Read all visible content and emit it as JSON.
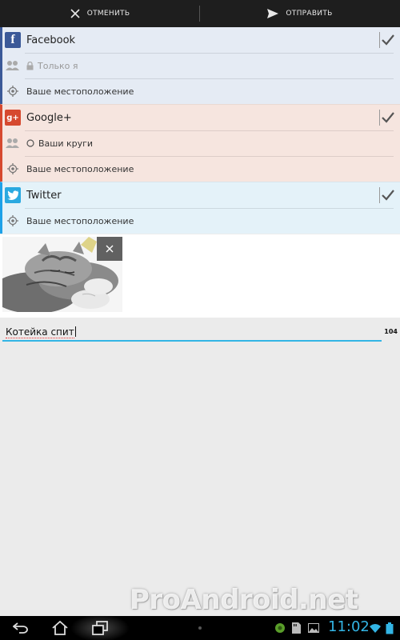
{
  "actionbar": {
    "cancel_label": "ОТМЕНИТЬ",
    "send_label": "ОТПРАВИТЬ"
  },
  "networks": [
    {
      "name": "Facebook",
      "checked": true,
      "audience": "Только я",
      "location": "Ваше местоположение"
    },
    {
      "name": "Google+",
      "checked": true,
      "audience": "Ваши круги",
      "location": "Ваше местоположение"
    },
    {
      "name": "Twitter",
      "checked": true,
      "location": "Ваше местоположение"
    }
  ],
  "compose": {
    "text": "Котейка спит",
    "char_counter": "104"
  },
  "watermark": "ProAndroid.net",
  "statusbar": {
    "time": "11:02"
  },
  "colors": {
    "facebook": "#3b5998",
    "googleplus": "#d6492f",
    "twitter": "#1da1e8",
    "accent": "#33b5e5"
  }
}
